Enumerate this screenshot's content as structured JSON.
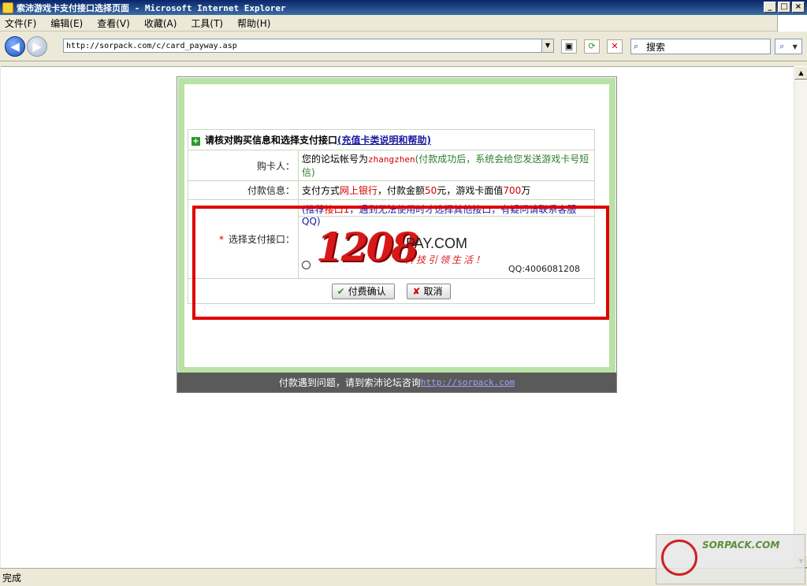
{
  "window": {
    "title": "索沛游戏卡支付接口选择页面 - Microsoft Internet Explorer"
  },
  "menu": [
    {
      "label": "文件(F)"
    },
    {
      "label": "编辑(E)"
    },
    {
      "label": "查看(V)"
    },
    {
      "label": "收藏(A)"
    },
    {
      "label": "工具(T)"
    },
    {
      "label": "帮助(H)"
    }
  ],
  "address": {
    "url": "http://sorpack.com/c/card_payway.asp"
  },
  "search": {
    "label": "搜索"
  },
  "page": {
    "header": "请核对购买信息和选择支付接口",
    "help_link": "(充值卡类说明和帮助)",
    "buyer_label": "购卡人：",
    "buyer_prefix": "您的论坛帐号为",
    "buyer_account": "zhangzhen",
    "buyer_note": "(付款成功后，系统会给您发送游戏卡号短信)",
    "payment_label": "付款信息：",
    "pay_p1": "支付方式",
    "pay_method": "网上银行",
    "pay_p2": "，付款金额",
    "pay_amount": "50",
    "pay_p3": "元，游戏卡面值",
    "pay_face": "700",
    "pay_p4": "万",
    "select_label": "选择支付接口：",
    "rec_open": "(推荐",
    "rec_iface": "接口1",
    "rec_rest": "，遇到无法使用时才选择其他接口，有疑问请联系客服QQ)",
    "logo_number": "1208",
    "logo_pay": "PAY.COM",
    "logo_slogan": "科技引领生活！",
    "logo_qq": "QQ:4006081208",
    "confirm_button": "付费确认",
    "cancel_button": "取消",
    "footer_text": "付款遇到问题，请到索沛论坛咨询",
    "footer_link": "http://sorpack.com"
  },
  "status": {
    "text": "完成"
  },
  "watermark": {
    "text": "SORPACK.COM"
  }
}
